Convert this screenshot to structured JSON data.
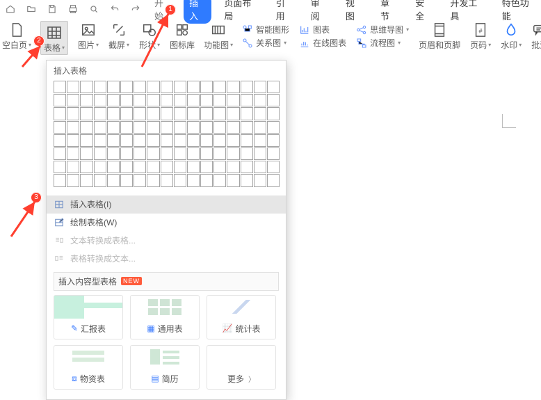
{
  "quick_access_icons": [
    "home",
    "folder",
    "save",
    "print",
    "preview",
    "undo",
    "redo"
  ],
  "tabs": {
    "begin": "开始",
    "insert": "插入",
    "layout": "页面布局",
    "ref": "引用",
    "review": "审阅",
    "view": "视图",
    "chapter": "章节",
    "safety": "安全",
    "dev": "开发工具",
    "special": "特色功能"
  },
  "ribbon": {
    "blank_page": "空白页",
    "table": "表格",
    "picture": "图片",
    "screenshot": "截屏",
    "shape": "形状",
    "icon_lib": "图标库",
    "func_chart": "功能图",
    "smart_shape": "智能图形",
    "chart": "图表",
    "relation": "关系图",
    "online_chart": "在线图表",
    "mindmap": "思维导图",
    "flow": "流程图",
    "header_footer": "页眉和页脚",
    "page_number": "页码",
    "watermark": "水印",
    "annotate": "批注"
  },
  "dropdown": {
    "title": "插入表格",
    "insert_table": "插入表格(I)",
    "draw_table": "绘制表格(W)",
    "text_to_table": "文本转换成表格...",
    "table_to_text": "表格转换成文本...",
    "content_table_title": "插入内容型表格",
    "new_badge": "NEW",
    "grid": {
      "cols": 17,
      "rows": 8
    },
    "templates": {
      "report": "汇报表",
      "general": "通用表",
      "stats": "统计表",
      "asset": "物资表",
      "resume": "简历",
      "more": "更多"
    }
  },
  "annotations": {
    "a1": "1",
    "a2": "2",
    "a3": "3"
  }
}
